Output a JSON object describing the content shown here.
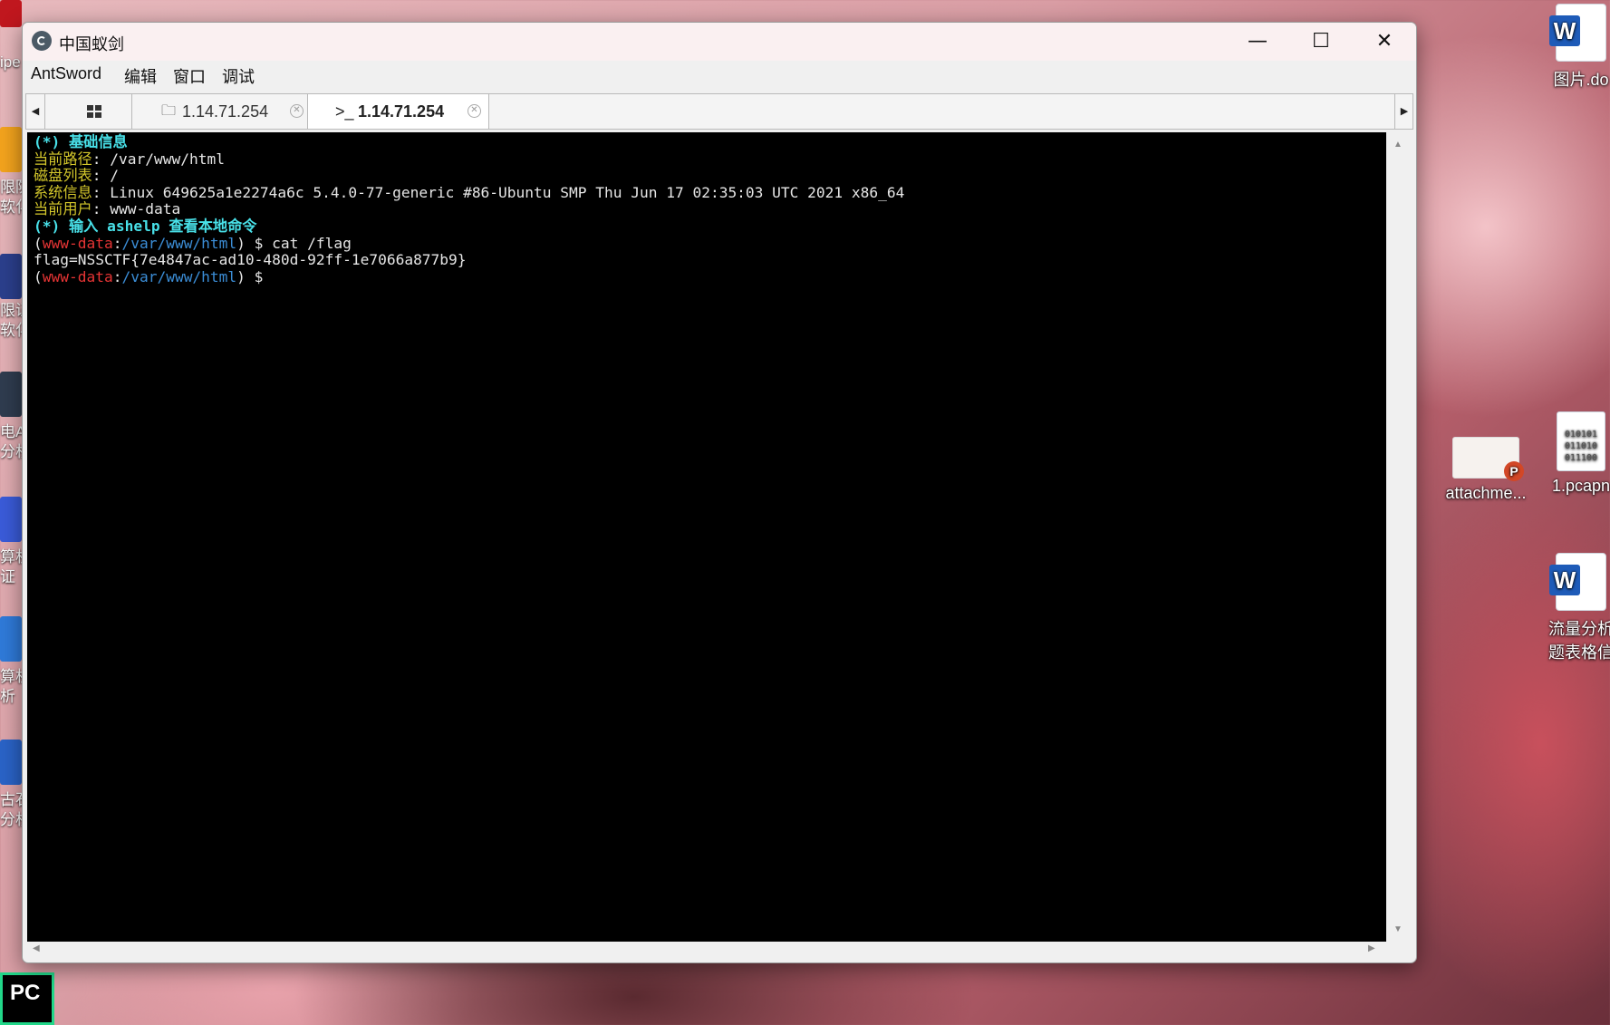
{
  "window": {
    "title": "中国蚁剑",
    "minimize_glyph": "—",
    "maximize_glyph": "☐",
    "close_glyph": "✕"
  },
  "menu": [
    "AntSword",
    "编辑",
    "窗口",
    "调试"
  ],
  "tabs": [
    {
      "label": "1.14.71.254",
      "icon": "folder-icon",
      "active": false
    },
    {
      "label": "1.14.71.254",
      "icon": "terminal-icon",
      "prefix": ">_",
      "active": true
    }
  ],
  "terminal": {
    "lines": [
      {
        "segments": [
          {
            "text": "(*) 基础信息",
            "color": "cyan"
          }
        ]
      },
      {
        "segments": [
          {
            "text": "当前路径",
            "color": "yellow"
          },
          {
            "text": ": /var/www/html",
            "color": "white"
          }
        ]
      },
      {
        "segments": [
          {
            "text": "磁盘列表",
            "color": "yellow"
          },
          {
            "text": ": /",
            "color": "white"
          }
        ]
      },
      {
        "segments": [
          {
            "text": "系统信息",
            "color": "yellow"
          },
          {
            "text": ": Linux 649625a1e2274a6c 5.4.0-77-generic #86-Ubuntu SMP Thu Jun 17 02:35:03 UTC 2021 x86_64",
            "color": "white"
          }
        ]
      },
      {
        "segments": [
          {
            "text": "当前用户",
            "color": "yellow"
          },
          {
            "text": ": www-data",
            "color": "white"
          }
        ]
      },
      {
        "segments": [
          {
            "text": "(*) 输入 ashelp 查看本地命令",
            "color": "cyan"
          }
        ]
      },
      {
        "segments": [
          {
            "text": "(",
            "color": "white"
          },
          {
            "text": "www-data",
            "color": "red"
          },
          {
            "text": ":",
            "color": "white"
          },
          {
            "text": "/var/www/html",
            "color": "blue"
          },
          {
            "text": ") $ cat /flag",
            "color": "white"
          }
        ]
      },
      {
        "segments": [
          {
            "text": "flag=NSSCTF{7e4847ac-ad10-480d-92ff-1e7066a877b9}",
            "color": "white"
          }
        ]
      },
      {
        "segments": [
          {
            "text": "(",
            "color": "white"
          },
          {
            "text": "www-data",
            "color": "red"
          },
          {
            "text": ":",
            "color": "white"
          },
          {
            "text": "/var/www/html",
            "color": "blue"
          },
          {
            "text": ") $",
            "color": "white"
          }
        ]
      }
    ]
  },
  "desktop": {
    "right_icons": [
      {
        "label": "图片.do",
        "type": "word"
      },
      {
        "label": "attachme...",
        "type": "ppt"
      },
      {
        "label": "1.pcapn",
        "type": "binary",
        "bin_lines": [
          "010101",
          "011010",
          "011100"
        ]
      },
      {
        "label": "流量分析",
        "label2": "题表格信",
        "type": "word"
      }
    ],
    "left_labels": [
      "ipe",
      "限防",
      "软化",
      "限证",
      "软化",
      "电A",
      "分析",
      "算机",
      "证",
      "算机",
      "析",
      "古石",
      "分析"
    ],
    "taskbar_icon": "PC"
  },
  "colors": {
    "cyan": "#48e0e8",
    "yellow": "#d4c72b",
    "red": "#e53434",
    "blue": "#3b8dd6",
    "white": "#e6e6e6"
  }
}
